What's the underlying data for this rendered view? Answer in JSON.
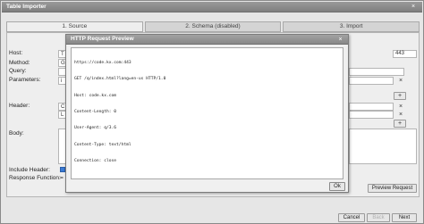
{
  "window": {
    "title": "Table Importer",
    "close_glyph": "×"
  },
  "tabs": [
    {
      "label": "1. Source",
      "active": true
    },
    {
      "label": "2. Schema (disabled)",
      "active": false
    },
    {
      "label": "3. Import",
      "active": false
    }
  ],
  "form": {
    "host_label": "Host:",
    "host_value": "T",
    "port_value": "443",
    "method_label": "Method:",
    "method_value": "G",
    "query_label": "Query:",
    "parameters_label": "Parameters:",
    "parameters_value": "i",
    "header_label": "Header:",
    "header_value_1": "C",
    "header_value_2": "L",
    "body_label": "Body:",
    "include_header_label": "Include Header:",
    "response_function_label": "Response Function:",
    "response_function_value": "=",
    "add_glyph": "+",
    "remove_glyph": "×",
    "preview_request_label": "Preview Request"
  },
  "footer": {
    "cancel_label": "Cancel",
    "back_label": "Back",
    "next_label": "Next"
  },
  "dialog": {
    "title": "HTTP Request Preview",
    "close_glyph": "×",
    "request_lines": [
      "https://code.kx.com:443",
      "GET /q/index.html?lang=en-us HTTP/1.0",
      "Host: code.kx.com",
      "Content-Length: 0",
      "User-Agent: q/3.6",
      "Content-Type: text/html",
      "Connection: close"
    ],
    "ok_label": "Ok"
  },
  "colors": {
    "title_bar": "#8a8a8a",
    "background": "#e6e6e6",
    "checkbox_accent": "#3a7bd5"
  }
}
